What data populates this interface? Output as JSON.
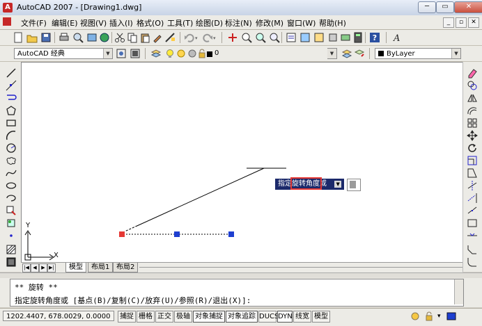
{
  "window": {
    "title": "AutoCAD 2007 - [Drawing1.dwg]",
    "controls": [
      "─",
      "▭",
      "✕"
    ]
  },
  "menu": {
    "items": [
      "文件(F)",
      "编辑(E)",
      "视图(V)",
      "插入(I)",
      "格式(O)",
      "工具(T)",
      "绘图(D)",
      "标注(N)",
      "修改(M)",
      "窗口(W)",
      "帮助(H)"
    ]
  },
  "toolbar2": {
    "workspace": "AutoCAD 经典",
    "layer": "0",
    "color": "ByLayer"
  },
  "drawing": {
    "dynamic_prompt": "指定旋转角度或",
    "ucs_x": "X",
    "ucs_y": "Y",
    "grip_colors": {
      "selected": "#e53935",
      "normal": "#1e3fd0"
    }
  },
  "tabs": {
    "items": [
      "模型",
      "布局1",
      "布局2"
    ],
    "active": "模型"
  },
  "command": {
    "line1": "** 旋转 **",
    "line2": "指定旋转角度或 [基点(B)/复制(C)/放弃(U)/参照(R)/退出(X)]:"
  },
  "status": {
    "coordinates": "1202.4407, 678.0029, 0.0000",
    "buttons": [
      "捕捉",
      "栅格",
      "正交",
      "极轴",
      "对象捕捉",
      "对象追踪",
      "DUCS",
      "DYN",
      "线宽",
      "模型"
    ]
  }
}
